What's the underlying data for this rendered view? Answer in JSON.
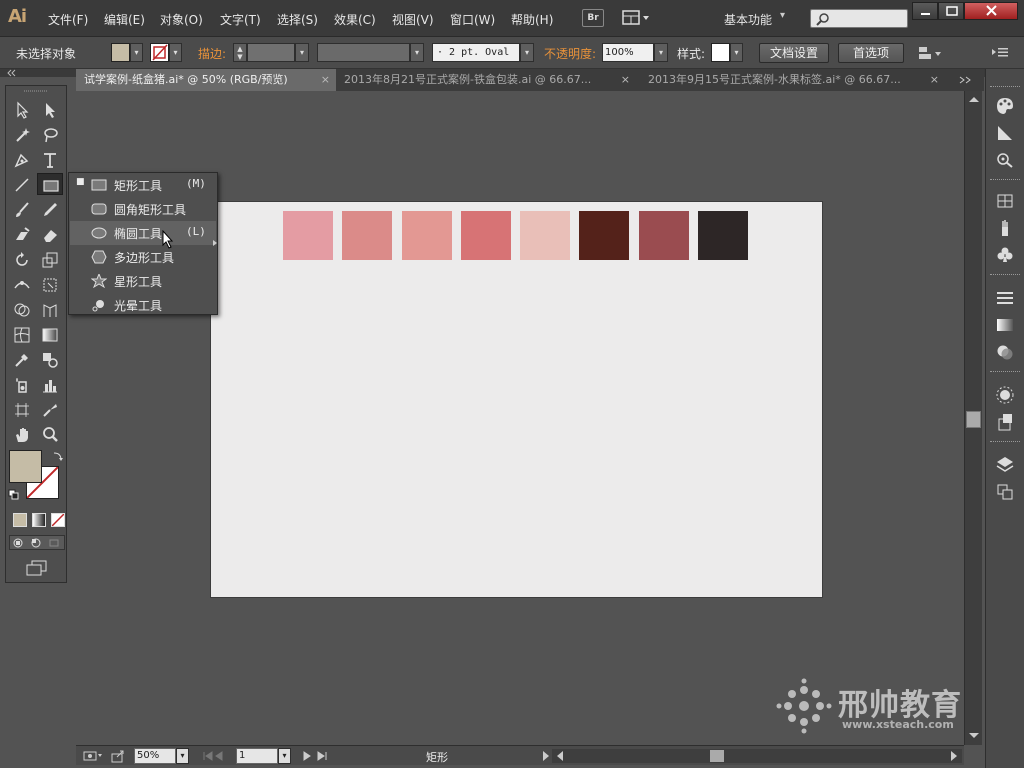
{
  "app": {
    "logo": "Ai",
    "workspace": "基本功能",
    "bridge_label": "Br"
  },
  "menu": [
    "文件(F)",
    "编辑(E)",
    "对象(O)",
    "文字(T)",
    "选择(S)",
    "效果(C)",
    "视图(V)",
    "窗口(W)",
    "帮助(H)"
  ],
  "control": {
    "selection_status": "未选择对象",
    "stroke_label": "描边:",
    "brush_value": "· 2 pt. Oval",
    "opacity_label": "不透明度:",
    "opacity_value": "100%",
    "style_label": "样式:",
    "doc_setup_button": "文档设置",
    "preferences_button": "首选项",
    "fill_color": "#c5bca6"
  },
  "tabs": [
    {
      "label": "试学案例-纸盒猪.ai* @ 50% (RGB/预览)",
      "close": "×",
      "active": true
    },
    {
      "label": "2013年8月21号正式案例-铁盒包装.ai @ 66.67...",
      "close": "×",
      "active": false
    },
    {
      "label": "2013年9月15号正式案例-水果标签.ai* @ 66.67...",
      "close": "×",
      "active": false
    }
  ],
  "flyout": {
    "items": [
      {
        "label": "矩形工具",
        "shortcut": "(M)",
        "icon": "rectangle-icon",
        "checked": true
      },
      {
        "label": "圆角矩形工具",
        "shortcut": "",
        "icon": "rounded-rectangle-icon",
        "checked": false
      },
      {
        "label": "椭圆工具",
        "shortcut": "(L)",
        "icon": "ellipse-icon",
        "checked": false
      },
      {
        "label": "多边形工具",
        "shortcut": "",
        "icon": "polygon-icon",
        "checked": false
      },
      {
        "label": "星形工具",
        "shortcut": "",
        "icon": "star-icon",
        "checked": false
      },
      {
        "label": "光晕工具",
        "shortcut": "",
        "icon": "flare-icon",
        "checked": false
      }
    ],
    "checked_mark": "■"
  },
  "artboard": {
    "swatches": [
      "#e49ca3",
      "#db8b89",
      "#e39893",
      "#d77375",
      "#e9bfb8",
      "#54221a",
      "#9a4c50",
      "#2d2626"
    ]
  },
  "status": {
    "zoom": "50%",
    "artboard_number": "1",
    "tool_name": "矩形"
  },
  "watermark": {
    "name": "邢帅教育",
    "url": "www.xsteach.com"
  }
}
